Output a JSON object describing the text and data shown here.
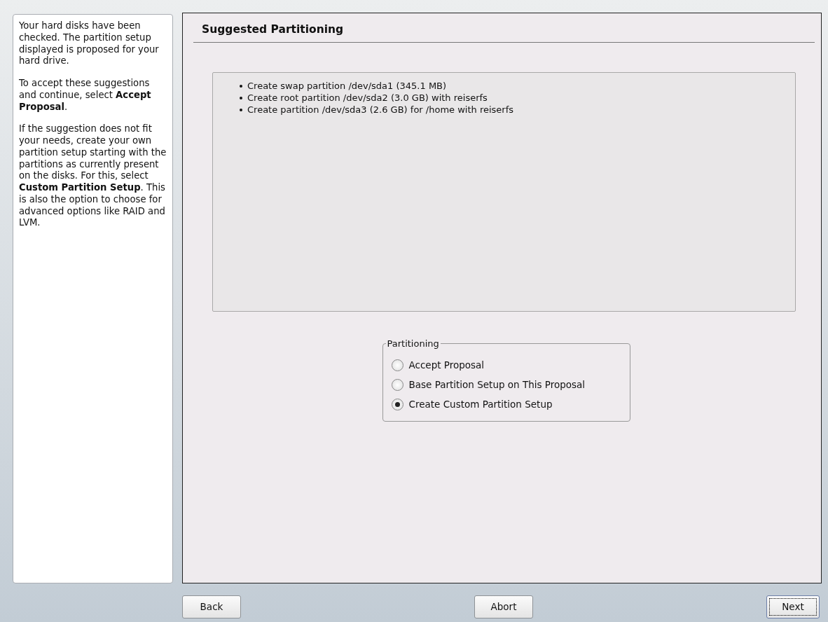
{
  "help": {
    "paragraphs": [
      "Your hard disks have been checked. The partition setup displayed is proposed for your hard drive.",
      "To accept these suggestions and continue, select **Accept Proposal**.",
      "If the suggestion does not fit your needs, create your own partition setup starting with the partitions as currently present on the disks. For this, select **Custom Partition Setup**. This is also the option to choose for advanced options like RAID and LVM."
    ]
  },
  "title": "Suggested Partitioning",
  "proposal": [
    "Create swap partition /dev/sda1 (345.1 MB)",
    "Create root partition /dev/sda2 (3.0 GB) with reiserfs",
    "Create partition /dev/sda3 (2.6 GB) for /home with reiserfs"
  ],
  "partitioning": {
    "legend": "Partitioning",
    "options": [
      {
        "label": "Accept Proposal",
        "selected": false
      },
      {
        "label": "Base Partition Setup on This Proposal",
        "selected": false
      },
      {
        "label": "Create Custom Partition Setup",
        "selected": true
      }
    ]
  },
  "buttons": [
    {
      "label": "Back",
      "focused": false
    },
    {
      "label": "Abort",
      "focused": false
    },
    {
      "label": "Next",
      "focused": true
    }
  ]
}
